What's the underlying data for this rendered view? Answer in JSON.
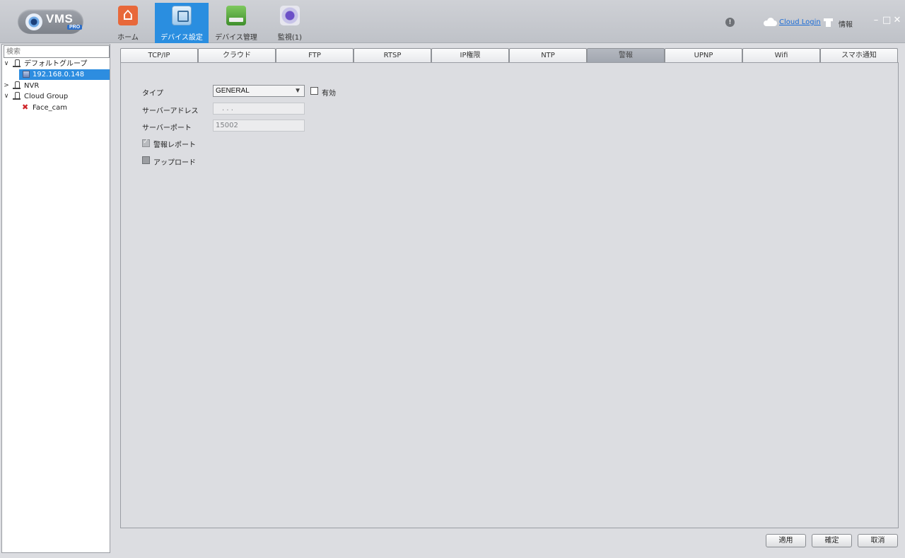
{
  "app": {
    "logo_text": "VMS",
    "logo_badge": "PRO"
  },
  "nav": [
    {
      "label": "ホーム",
      "icon": "home-icon"
    },
    {
      "label": "デバイス設定",
      "icon": "device-settings-icon",
      "active": true
    },
    {
      "label": "デバイス管理",
      "icon": "device-management-icon"
    },
    {
      "label": "監視(1)",
      "icon": "monitor-icon"
    }
  ],
  "header": {
    "info_badge": "!",
    "cloud_login": "Cloud Login",
    "info_label": "情報",
    "window": {
      "minimize": "–",
      "maximize": "□",
      "close": "✕"
    }
  },
  "sidebar": {
    "search_placeholder": "検索",
    "tree": [
      {
        "label": "デフォルトグループ",
        "toggle": "∨"
      },
      {
        "label": "192.168.0.148",
        "selected": true
      },
      {
        "label": "NVR",
        "toggle": ">"
      },
      {
        "label": "Cloud Group",
        "toggle": "∨"
      },
      {
        "label": "Face_cam",
        "status_icon": "✖"
      }
    ]
  },
  "tabs": [
    "TCP/IP",
    "クラウド",
    "FTP",
    "RTSP",
    "IP権限",
    "NTP",
    "警報",
    "UPNP",
    "Wifi",
    "スマホ通知"
  ],
  "active_tab": "警報",
  "form": {
    "type_label": "タイプ",
    "type_value": "GENERAL",
    "type_arrow": "▼",
    "enable_label": "有効",
    "server_address_label": "サーバーアドレス",
    "server_address_value": ".    .    .",
    "server_port_label": "サーバーポート",
    "server_port_value": "15002",
    "alarm_report_label": "警報レポート",
    "upload_label": "アップロード"
  },
  "buttons": {
    "apply": "適用",
    "ok": "確定",
    "cancel": "取消"
  }
}
